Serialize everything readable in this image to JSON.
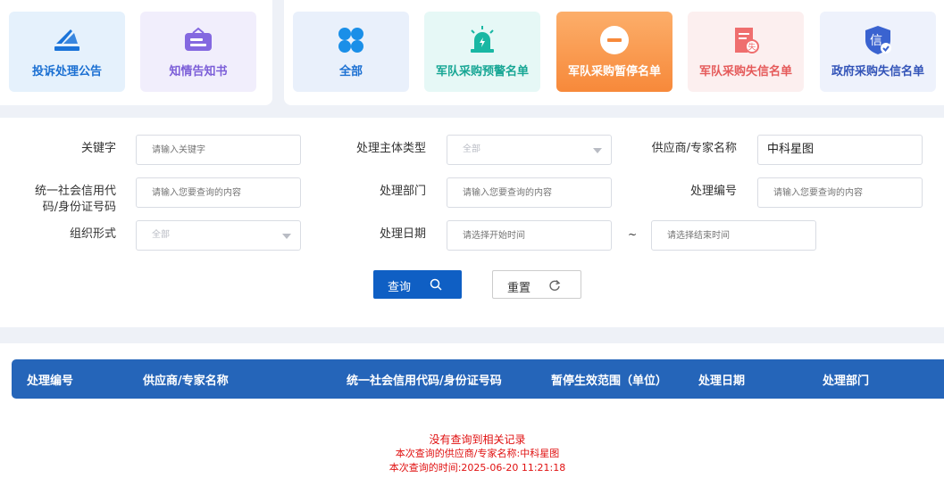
{
  "cards_left": [
    {
      "label": "投诉处理公告",
      "icon": "megaphone-icon"
    },
    {
      "label": "知情告知书",
      "icon": "notice-board-icon"
    }
  ],
  "cards_right": [
    {
      "label": "全部",
      "icon": "four-leaf-icon"
    },
    {
      "label": "军队采购预警名单",
      "icon": "alarm-light-icon"
    },
    {
      "label": "军队采购暂停名单",
      "icon": "minus-circle-icon",
      "active": true
    },
    {
      "label": "军队采购失信名单",
      "icon": "dishonest-document-icon"
    },
    {
      "label": "政府采购失信名单",
      "icon": "shield-credit-icon"
    }
  ],
  "form": {
    "keyword_label": "关键字",
    "keyword_placeholder": "请输入关键字",
    "subject_type_label": "处理主体类型",
    "subject_type_value": "全部",
    "supplier_label": "供应商/专家名称",
    "supplier_value": "中科星图",
    "credit_code_label_1": "统一社会信用代",
    "credit_code_label_2": "码/身份证号码",
    "credit_code_placeholder": "请输入您要查询的内容",
    "dept_label": "处理部门",
    "dept_placeholder": "请输入您要查询的内容",
    "number_label": "处理编号",
    "number_placeholder": "请输入您要查询的内容",
    "org_form_label": "组织形式",
    "org_form_value": "全部",
    "date_label": "处理日期",
    "date_start_placeholder": "请选择开始时间",
    "date_separator": "~",
    "date_end_placeholder": "请选择结束时间"
  },
  "buttons": {
    "query": "查询",
    "reset": "重置"
  },
  "table": {
    "headers": [
      "处理编号",
      "供应商/专家名称",
      "统一社会信用代码/身份证号码",
      "暂停生效范围（单位）",
      "处理日期",
      "处理部门"
    ]
  },
  "result": {
    "line1": "没有查询到相关记录",
    "line2": "本次查询的供应商/专家名称:中科星图",
    "line3": "本次查询的时间:2025-06-20 11:21:18"
  },
  "colors": {
    "primary": "#0f5fc4",
    "table_header": "#2565b9",
    "active_card": "#f98f3a",
    "error_text": "#e01010"
  }
}
